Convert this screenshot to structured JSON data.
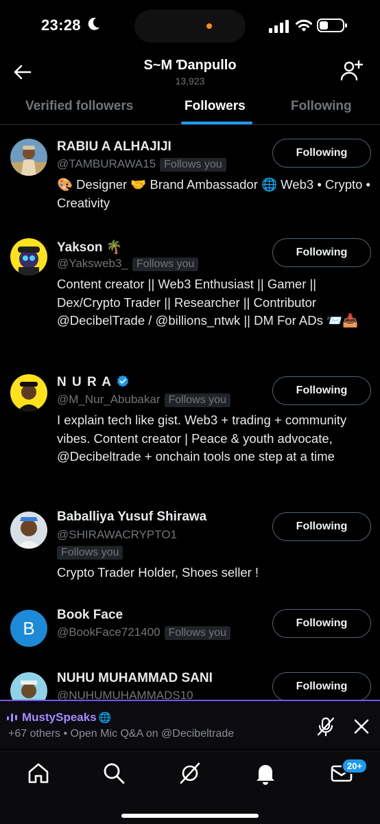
{
  "status_bar": {
    "time": "23:28"
  },
  "header": {
    "title": "S~M Ɗanpullo",
    "subtitle": "13,923"
  },
  "tabs": [
    {
      "label": "Verified followers",
      "active": false
    },
    {
      "label": "Followers",
      "active": true
    },
    {
      "label": "Following",
      "active": false
    }
  ],
  "followers": [
    {
      "name": "RABIU A ALHAJIJI",
      "handle": "@TAMBURAWA15",
      "follows_you": "Follows you",
      "bio": "🎨 Designer 🤝 Brand Ambassador 🌐 Web3 • Crypto • Creativity",
      "button": "Following"
    },
    {
      "name": "Yakson 🌴",
      "handle": "@Yaksweb3_",
      "follows_you": "Follows you",
      "bio": "Content creator || Web3 Enthusiast || Gamer || Dex/Crypto Trader || Researcher || Contributor @DecibelTrade / @billions_ntwk || DM For ADs 📨📥",
      "button": "Following"
    },
    {
      "name": "N U R A",
      "verified": true,
      "handle": "@M_Nur_Abubakar",
      "follows_you": "Follows you",
      "bio": "I explain tech like gist. Web3 + trading + community vibes. Content creator | Peace & youth advocate, @Decibeltrade + onchain tools one step at a time",
      "button": "Following"
    },
    {
      "name": "Baballiya Yusuf Shirawa",
      "handle": "@SHIRAWACRYPTO1",
      "follows_you": "Follows you",
      "bio": "Crypto Trader Holder, Shoes seller !",
      "button": "Following"
    },
    {
      "name": "Book Face",
      "avatar_letter": "B",
      "handle": "@BookFace721400",
      "follows_you": "Follows you",
      "button": "Following"
    },
    {
      "name": "NUHU MUHAMMAD SANI",
      "handle": "@NUHUMUHAMMADS10",
      "button": "Following"
    }
  ],
  "space": {
    "host": "MustySpeaks",
    "host_emoji": "🌐",
    "subtitle": "+67 others • Open Mic Q&A on @Decibeltrade"
  },
  "bottom_nav": {
    "icons": [
      "home-icon",
      "search-icon",
      "grok-icon",
      "bell-icon",
      "mail-icon"
    ],
    "dm_badge": "20+"
  },
  "colors": {
    "accent": "#1d9bf0",
    "space_purple": "#7856ff",
    "muted": "#71767b",
    "background": "#000000"
  }
}
